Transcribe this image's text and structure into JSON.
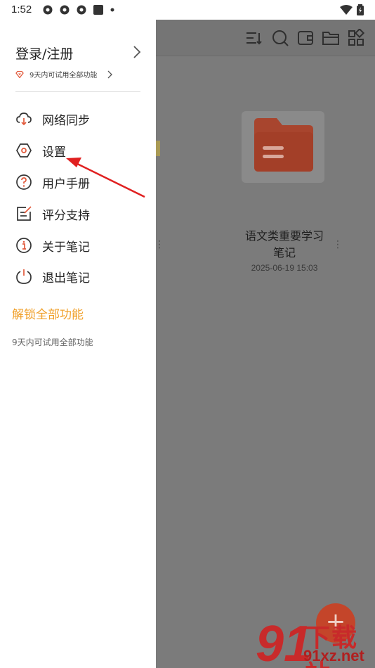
{
  "status_bar": {
    "time": "1:52",
    "icons": [
      "settings-gear-icon",
      "settings-gear-icon",
      "settings-gear-icon",
      "square-icon",
      "dot-icon"
    ],
    "right_icons": [
      "wifi-icon",
      "battery-icon"
    ]
  },
  "drawer": {
    "login_label": "登录/注册",
    "trial_text": "9天内可试用全部功能",
    "menu": [
      {
        "label": "网络同步",
        "icon": "cloud-sync-icon"
      },
      {
        "label": "设置",
        "icon": "settings-hexagon-icon"
      },
      {
        "label": "用户手册",
        "icon": "help-circle-icon"
      },
      {
        "label": "评分支持",
        "icon": "edit-note-icon"
      },
      {
        "label": "关于笔记",
        "icon": "info-circle-icon"
      },
      {
        "label": "退出笔记",
        "icon": "power-icon"
      }
    ],
    "unlock_label": "解锁全部功能",
    "unlock_sub": "9天内可试用全部功能",
    "accent_color": "#f0a02a"
  },
  "background": {
    "toolbar_icons": [
      "sort-icon",
      "search-icon",
      "wallet-icon",
      "folder-icon",
      "grid-icon"
    ],
    "note": {
      "title_line1": "语文类重要学习",
      "title_line2": "笔记",
      "date": "2025-06-19 15:03"
    },
    "fab_label": "+"
  },
  "watermark": {
    "logo_text": "91",
    "chinese": "下载站",
    "domain": "91xz.net"
  }
}
